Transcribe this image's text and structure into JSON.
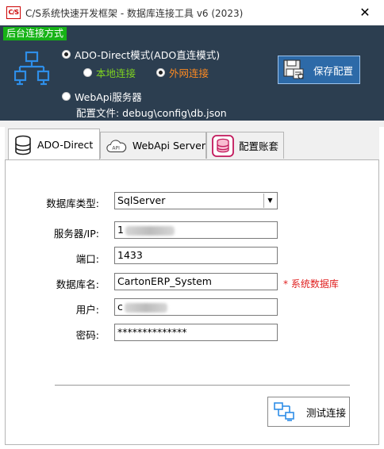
{
  "window": {
    "icon_text": "C/S",
    "title": "C/S系统快速开发框架 - 数据库连接工具 v6 (2023)",
    "close_glyph": "✕"
  },
  "connection": {
    "group_label": "后台连接方式",
    "network_icon": "network-topology-icon",
    "ado_direct_label": "ADO-Direct模式(ADO直连模式)",
    "ado_direct_selected": true,
    "local_label": "本地连接",
    "local_selected": false,
    "external_label": "外网连接",
    "external_selected": true,
    "webapi_label": "WebApi服务器",
    "webapi_selected": false,
    "config_file": "配置文件: debug\\config\\db.json",
    "save_label": "保存配置"
  },
  "tabs": [
    {
      "label": "ADO-Direct",
      "icon": "database-icon",
      "active": true
    },
    {
      "label": "WebApi Server",
      "icon": "api-cloud-icon",
      "active": false
    },
    {
      "label": "配置账套",
      "icon": "database-config-icon",
      "active": false
    }
  ],
  "form": {
    "db_type_label": "数据库类型:",
    "db_type_value": "SqlServer",
    "server_label": "服务器/IP:",
    "server_value": "1",
    "port_label": "端口:",
    "port_value": "1433",
    "db_name_label": "数据库名:",
    "db_name_value": "CartonERP_System",
    "db_name_note": "* 系统数据库",
    "user_label": "用户:",
    "user_value": "c",
    "password_label": "密码:",
    "password_value": "**************",
    "test_label": "测试连接"
  },
  "colors": {
    "panel_bg": "#2c3e50",
    "group_label_bg": "#16b216",
    "local_text": "#7fd320",
    "external_text": "#ff8a20",
    "save_button_bg": "#2d6aa8",
    "note_red": "#e02020"
  }
}
